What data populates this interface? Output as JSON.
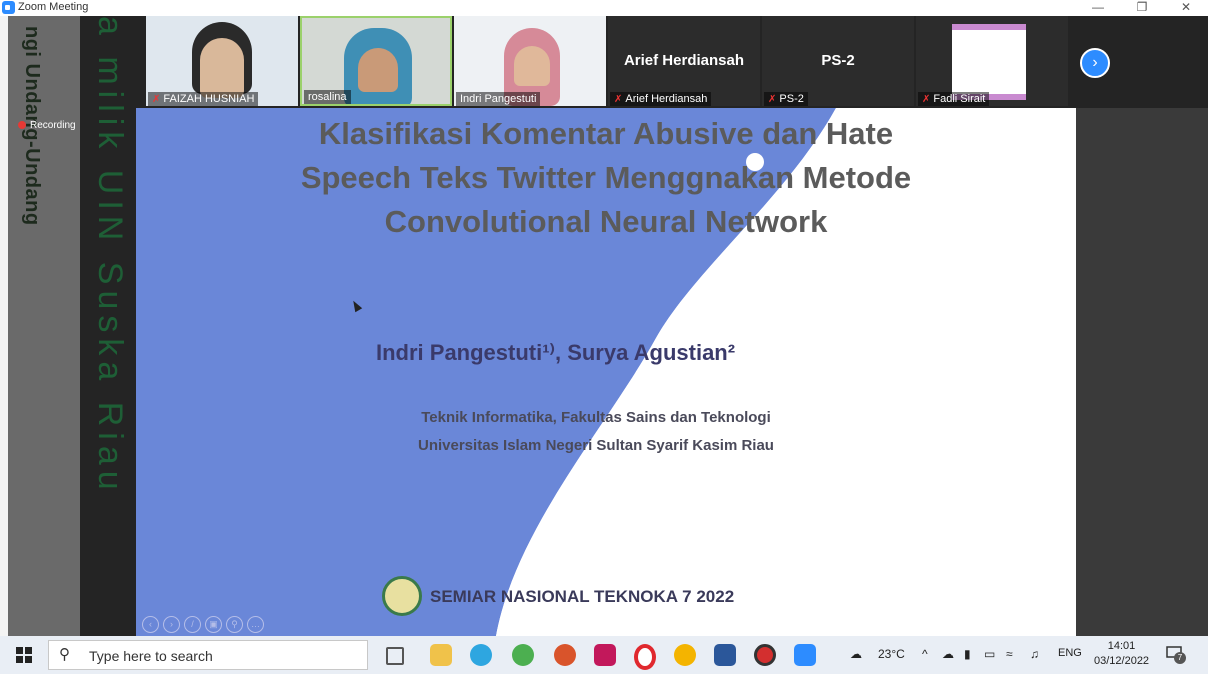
{
  "window": {
    "title": "Zoom Meeting"
  },
  "watermark": {
    "vertical_text_1": "ngi Undang-Undang",
    "vertical_text_2": "a milik UIN Suska Riau"
  },
  "participants": [
    {
      "name": "FAIZAH HUSNIAH",
      "muted": true,
      "video": true
    },
    {
      "name": "rosalina",
      "muted": false,
      "video": true
    },
    {
      "name": "Indri Pangestuti",
      "muted": false,
      "video": true
    },
    {
      "name": "Arief Herdiansah",
      "muted": true,
      "video": false,
      "display": "Arief Herdiansah"
    },
    {
      "name": "PS-2",
      "muted": true,
      "video": false,
      "display": "PS-2"
    },
    {
      "name": "Fadli Sirait",
      "muted": true,
      "video": false,
      "display": ""
    }
  ],
  "recording": {
    "label": "Recording"
  },
  "slide": {
    "title_line_1": "Klasifikasi Komentar Abusive dan Hate",
    "title_line_2": "Speech Teks Twitter Menggnakan Metode",
    "title_line_3": "Convolutional Neural Network",
    "authors": "Indri Pangestuti¹⁾, Surya Agustian²",
    "affiliation_1": "Teknik Informatika, Fakultas Sains dan Teknologi",
    "affiliation_2": "Universitas Islam Negeri Sultan Syarif Kasim Riau",
    "footer": "SEMIAR NASIONAL TEKNOKA 7 2022",
    "accent_color": "#6a87d8"
  },
  "taskbar": {
    "search_placeholder": "Type here to search",
    "weather": "23°C",
    "language": "ENG",
    "time": "14:01",
    "date": "03/12/2022",
    "notification_count": "7"
  }
}
